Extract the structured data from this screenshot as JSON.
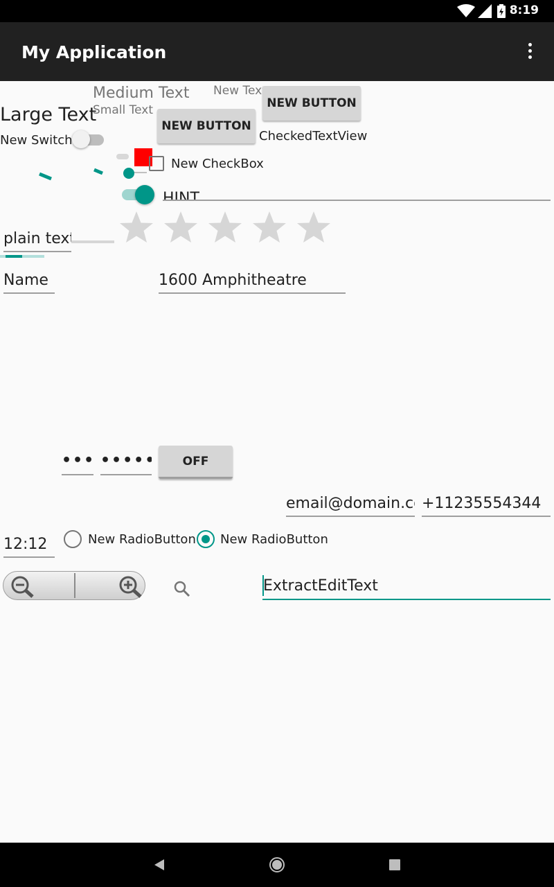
{
  "status_bar": {
    "time": "8:19",
    "icons": [
      "wifi-icon",
      "signal-icon",
      "battery-icon"
    ]
  },
  "action_bar": {
    "title": "My Application",
    "overflow_icon": "more-vert-icon"
  },
  "texts": {
    "large": "Large Text",
    "medium": "Medium Text",
    "small": "Small Text",
    "new_text": "New Text"
  },
  "buttons": {
    "new_button_1": "NEW BUTTON",
    "new_button_2": "NEW BUTTON",
    "toggle_off": "OFF"
  },
  "switch": {
    "label": "New Switch",
    "checked": false
  },
  "checked_text_view": "CheckedTextView",
  "checkbox": {
    "label": "New CheckBox",
    "checked": false
  },
  "hint_field": {
    "placeholder": "HINT"
  },
  "rating": {
    "stars": 5,
    "value": 0
  },
  "plain_text": {
    "value": "plain text"
  },
  "name_field": {
    "value": "Name"
  },
  "address_field": {
    "value": "1600 Amphitheatre"
  },
  "password_1": {
    "value": "•••"
  },
  "password_2": {
    "value": "•••••"
  },
  "email_field": {
    "value": "email@domain.com"
  },
  "phone_field": {
    "value": "+11235554344"
  },
  "time_field": {
    "value": "12:12"
  },
  "radios": [
    {
      "label": "New RadioButton",
      "checked": false
    },
    {
      "label": "New RadioButton",
      "checked": true
    }
  ],
  "extract_edit_text": {
    "value": "ExtractEditText"
  },
  "zoom": {
    "out_icon": "zoom-out-icon",
    "in_icon": "zoom-in-icon"
  },
  "search_icon": "search-icon",
  "colors": {
    "accent": "#009688",
    "action_bar": "#212121",
    "status_bar": "#000000",
    "red_square": "#ff0000",
    "background": "#fafafa"
  }
}
